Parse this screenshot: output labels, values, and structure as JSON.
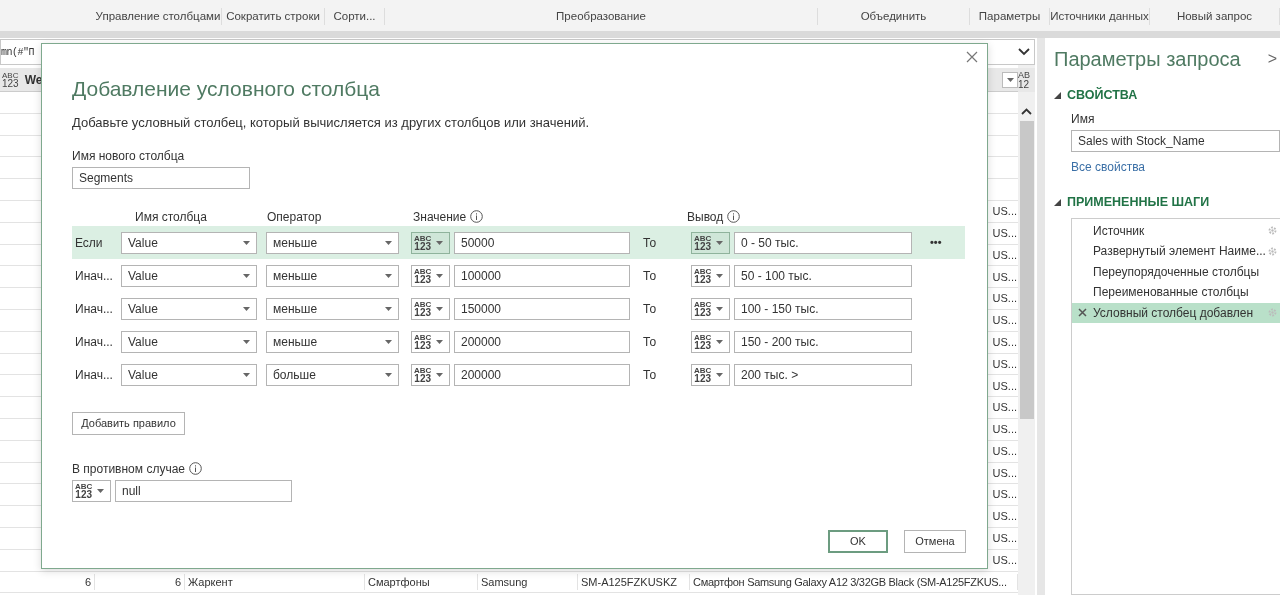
{
  "ribbon": {
    "groups": [
      "Управление столбцами",
      "Сократить строки",
      "Сорти...",
      "Преобразование",
      "Объединить",
      "Параметры",
      "Источники данных",
      "Новый запрос"
    ]
  },
  "formula_bar": {
    "value": "mn(#\"П"
  },
  "grid": {
    "header": {
      "type": [
        "ABC",
        "123"
      ],
      "label": "We",
      "right_type": [
        "AB",
        "12"
      ]
    },
    "rows": [
      {
        "cells": []
      },
      {
        "cells": []
      },
      {
        "cells": []
      },
      {
        "cells": []
      },
      {
        "cells": []
      },
      {
        "cells": [
          "US..."
        ]
      },
      {
        "cells": [
          "US..."
        ]
      },
      {
        "cells": [
          "US..."
        ]
      },
      {
        "cells": [
          "US..."
        ]
      },
      {
        "cells": [
          "US..."
        ]
      },
      {
        "cells": [
          "US..."
        ]
      },
      {
        "cells": [
          "US..."
        ]
      },
      {
        "cells": [
          "US..."
        ]
      },
      {
        "cells": [
          "US..."
        ]
      },
      {
        "cells": [
          "US..."
        ]
      },
      {
        "cells": [
          "US..."
        ]
      },
      {
        "cells": [
          "US..."
        ]
      },
      {
        "cells": [
          "US..."
        ]
      },
      {
        "cells": [
          "US..."
        ]
      },
      {
        "cells": [
          "US..."
        ]
      },
      {
        "cells": [
          "US..."
        ]
      },
      {
        "cells": [
          "US..."
        ]
      },
      {
        "cells": [
          "6",
          "6",
          "Жаркент",
          "Смартфоны",
          "Samsung",
          "SM-A125FZKUSKZ",
          "Смартфон Samsung Galaxy A12 3/32GB Black (SM-A125FZKUS..."
        ]
      }
    ]
  },
  "dialog": {
    "title": "Добавление условного столбца",
    "description": "Добавьте условный столбец, который вычисляется из других столбцов или значений.",
    "name_label": "Имя нового столбца",
    "name_value": "Segments",
    "headers": {
      "column": "Имя столбца",
      "operator": "Оператор",
      "value": "Значение",
      "output": "Вывод"
    },
    "rules": [
      {
        "label": "Если",
        "column": "Value",
        "operator": "меньше",
        "value_type": [
          "ABC",
          "123"
        ],
        "value": "50000",
        "then": "То",
        "output_type": [
          "ABC",
          "123"
        ],
        "output": "0 - 50 тыс.",
        "selected": true,
        "more": "•••"
      },
      {
        "label": "Инач...",
        "column": "Value",
        "operator": "меньше",
        "value_type": [
          "ABC",
          "123"
        ],
        "value": "100000",
        "then": "То",
        "output_type": [
          "ABC",
          "123"
        ],
        "output": "50 - 100 тыс.",
        "selected": false
      },
      {
        "label": "Инач...",
        "column": "Value",
        "operator": "меньше",
        "value_type": [
          "ABC",
          "123"
        ],
        "value": "150000",
        "then": "То",
        "output_type": [
          "ABC",
          "123"
        ],
        "output": "100 - 150 тыс.",
        "selected": false
      },
      {
        "label": "Инач...",
        "column": "Value",
        "operator": "меньше",
        "value_type": [
          "ABC",
          "123"
        ],
        "value": "200000",
        "then": "То",
        "output_type": [
          "ABC",
          "123"
        ],
        "output": "150 - 200 тыс.",
        "selected": false
      },
      {
        "label": "Инач...",
        "column": "Value",
        "operator": "больше",
        "value_type": [
          "ABC",
          "123"
        ],
        "value": "200000",
        "then": "То",
        "output_type": [
          "ABC",
          "123"
        ],
        "output": "200 тыс. >",
        "selected": false
      }
    ],
    "add_rule": "Добавить правило",
    "else_label": "В противном случае",
    "else_type": [
      "ABC",
      "123"
    ],
    "else_value": "null",
    "ok": "OK",
    "cancel": "Отмена"
  },
  "query_settings": {
    "title": "Параметры запроса",
    "collapse": ">",
    "properties": {
      "heading": "СВОЙСТВА",
      "expanded": true,
      "name_label": "Имя",
      "name_value": "Sales with Stock_Name",
      "all_link": "Все свойства"
    },
    "steps": {
      "heading": "ПРИМЕНЕННЫЕ ШАГИ",
      "expanded": true,
      "items": [
        {
          "label": "Источник",
          "gear": true,
          "selected": false
        },
        {
          "label": "Развернутый элемент Наиме...",
          "gear": true,
          "selected": false
        },
        {
          "label": "Переупорядоченные столбцы",
          "gear": false,
          "selected": false
        },
        {
          "label": "Переименованные столбцы",
          "gear": false,
          "selected": false
        },
        {
          "label": "Условный столбец добавлен",
          "gear": true,
          "selected": true
        }
      ]
    }
  }
}
